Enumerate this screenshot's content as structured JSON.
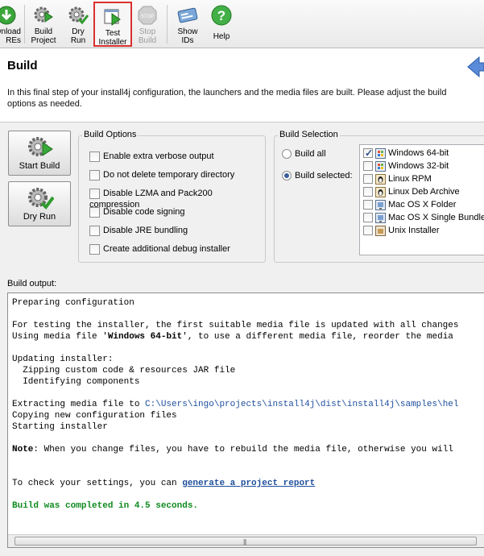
{
  "toolbar": {
    "items": [
      {
        "label": "wnload\nREs",
        "icon": "download-jre-icon"
      },
      {
        "label": "Build\nProject",
        "icon": "build-gear-icon"
      },
      {
        "label": "Dry\nRun",
        "icon": "dry-run-gear-icon"
      },
      {
        "label": "Test\nInstaller",
        "icon": "test-installer-icon"
      },
      {
        "label": "Stop\nBuild",
        "icon": "stop-icon"
      },
      {
        "label": "Show\nIDs",
        "icon": "show-ids-icon"
      },
      {
        "label": "Help",
        "icon": "help-icon"
      }
    ]
  },
  "header": {
    "title": "Build",
    "description": "In this final step of your install4j configuration, the launchers and the media files are built. Please adjust the build options as needed."
  },
  "actions": {
    "start_build": "Start Build",
    "dry_run": "Dry Run"
  },
  "build_options": {
    "title": "Build Options",
    "items": [
      {
        "label": "Enable extra verbose output",
        "checked": false
      },
      {
        "label": "Do not delete temporary directory",
        "checked": false
      },
      {
        "label": "Disable LZMA and Pack200 compression",
        "checked": false
      },
      {
        "label": "Disable code signing",
        "checked": false
      },
      {
        "label": "Disable JRE bundling",
        "checked": false
      },
      {
        "label": "Create additional debug installer",
        "checked": false
      }
    ]
  },
  "build_selection": {
    "title": "Build Selection",
    "build_all": "Build all",
    "build_selected": "Build selected:",
    "selected_mode": "selected",
    "media": [
      {
        "label": "Windows 64-bit",
        "checked": true,
        "icon": "windows-media-icon"
      },
      {
        "label": "Windows 32-bit",
        "checked": false,
        "icon": "windows-media-icon"
      },
      {
        "label": "Linux RPM",
        "checked": false,
        "icon": "linux-media-icon"
      },
      {
        "label": "Linux Deb Archive",
        "checked": false,
        "icon": "linux-media-icon"
      },
      {
        "label": "Mac OS X Folder",
        "checked": false,
        "icon": "mac-media-icon"
      },
      {
        "label": "Mac OS X Single Bundle",
        "checked": false,
        "icon": "mac-media-icon"
      },
      {
        "label": "Unix Installer",
        "checked": false,
        "icon": "unix-media-icon"
      }
    ]
  },
  "output": {
    "label": "Build output:",
    "lines": {
      "l1": "Preparing configuration",
      "l2": "For testing the installer, the first suitable media file is updated with all changes",
      "l3a": "Using media file '",
      "l3b": "Windows 64-bit",
      "l3c": "', to use a different media file, reorder the media",
      "l4": "Updating installer:",
      "l5": "  Zipping custom code & resources JAR file",
      "l6": "  Identifying components",
      "l7a": "Extracting media file to ",
      "l7b": "C:\\Users\\ingo\\projects\\install4j\\dist\\install4j\\samples\\hel",
      "l8": "Copying new configuration files",
      "l9": "Starting installer",
      "l10a": "Note",
      "l10b": ": When you change files, you have to rebuild the media file, otherwise you will",
      "l11a": "To check your settings, you can ",
      "l11b": "generate a project report",
      "l12": "Build was completed in 4.5 seconds."
    }
  },
  "colors": {
    "highlight_border": "#d9302e",
    "link": "#1f4f9b",
    "success": "#0e8a1e"
  }
}
